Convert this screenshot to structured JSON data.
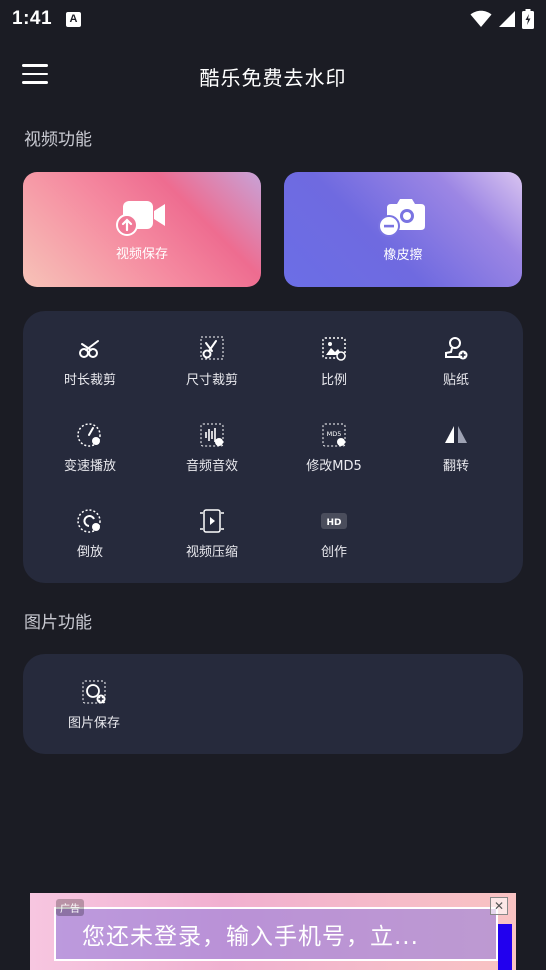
{
  "status_bar": {
    "time": "1:41",
    "notification_icon": "A"
  },
  "app_bar": {
    "title": "酷乐免费去水印"
  },
  "video_section": {
    "title": "视频功能",
    "cards": [
      {
        "label": "视频保存",
        "icon": "video-camera-upload-icon"
      },
      {
        "label": "橡皮擦",
        "icon": "camera-minus-icon"
      }
    ],
    "tools": [
      {
        "label": "时长裁剪",
        "icon": "scissors-icon"
      },
      {
        "label": "尺寸裁剪",
        "icon": "size-scissors-icon"
      },
      {
        "label": "比例",
        "icon": "image-ratio-icon"
      },
      {
        "label": "贴纸",
        "icon": "stamp-icon"
      },
      {
        "label": "变速播放",
        "icon": "speed-gauge-icon"
      },
      {
        "label": "音频音效",
        "icon": "audio-wave-icon"
      },
      {
        "label": "修改MD5",
        "icon": "md5-icon"
      },
      {
        "label": "翻转",
        "icon": "flip-icon"
      },
      {
        "label": "倒放",
        "icon": "reverse-icon"
      },
      {
        "label": "视频压缩",
        "icon": "video-compress-icon"
      },
      {
        "label": "创作",
        "icon": "hd-icon"
      }
    ],
    "hd_badge": "HD",
    "md5_badge": "MD5"
  },
  "image_section": {
    "title": "图片功能",
    "tools": [
      {
        "label": "图片保存",
        "icon": "image-save-icon"
      }
    ]
  },
  "ad": {
    "tag": "广告",
    "text": "您还未登录，输入手机号，立..."
  },
  "colors": {
    "background": "#1b1c24",
    "panel": "#262a3c",
    "save_card_accent": "#f58aa0",
    "eraser_card_accent": "#6f6ae0"
  }
}
